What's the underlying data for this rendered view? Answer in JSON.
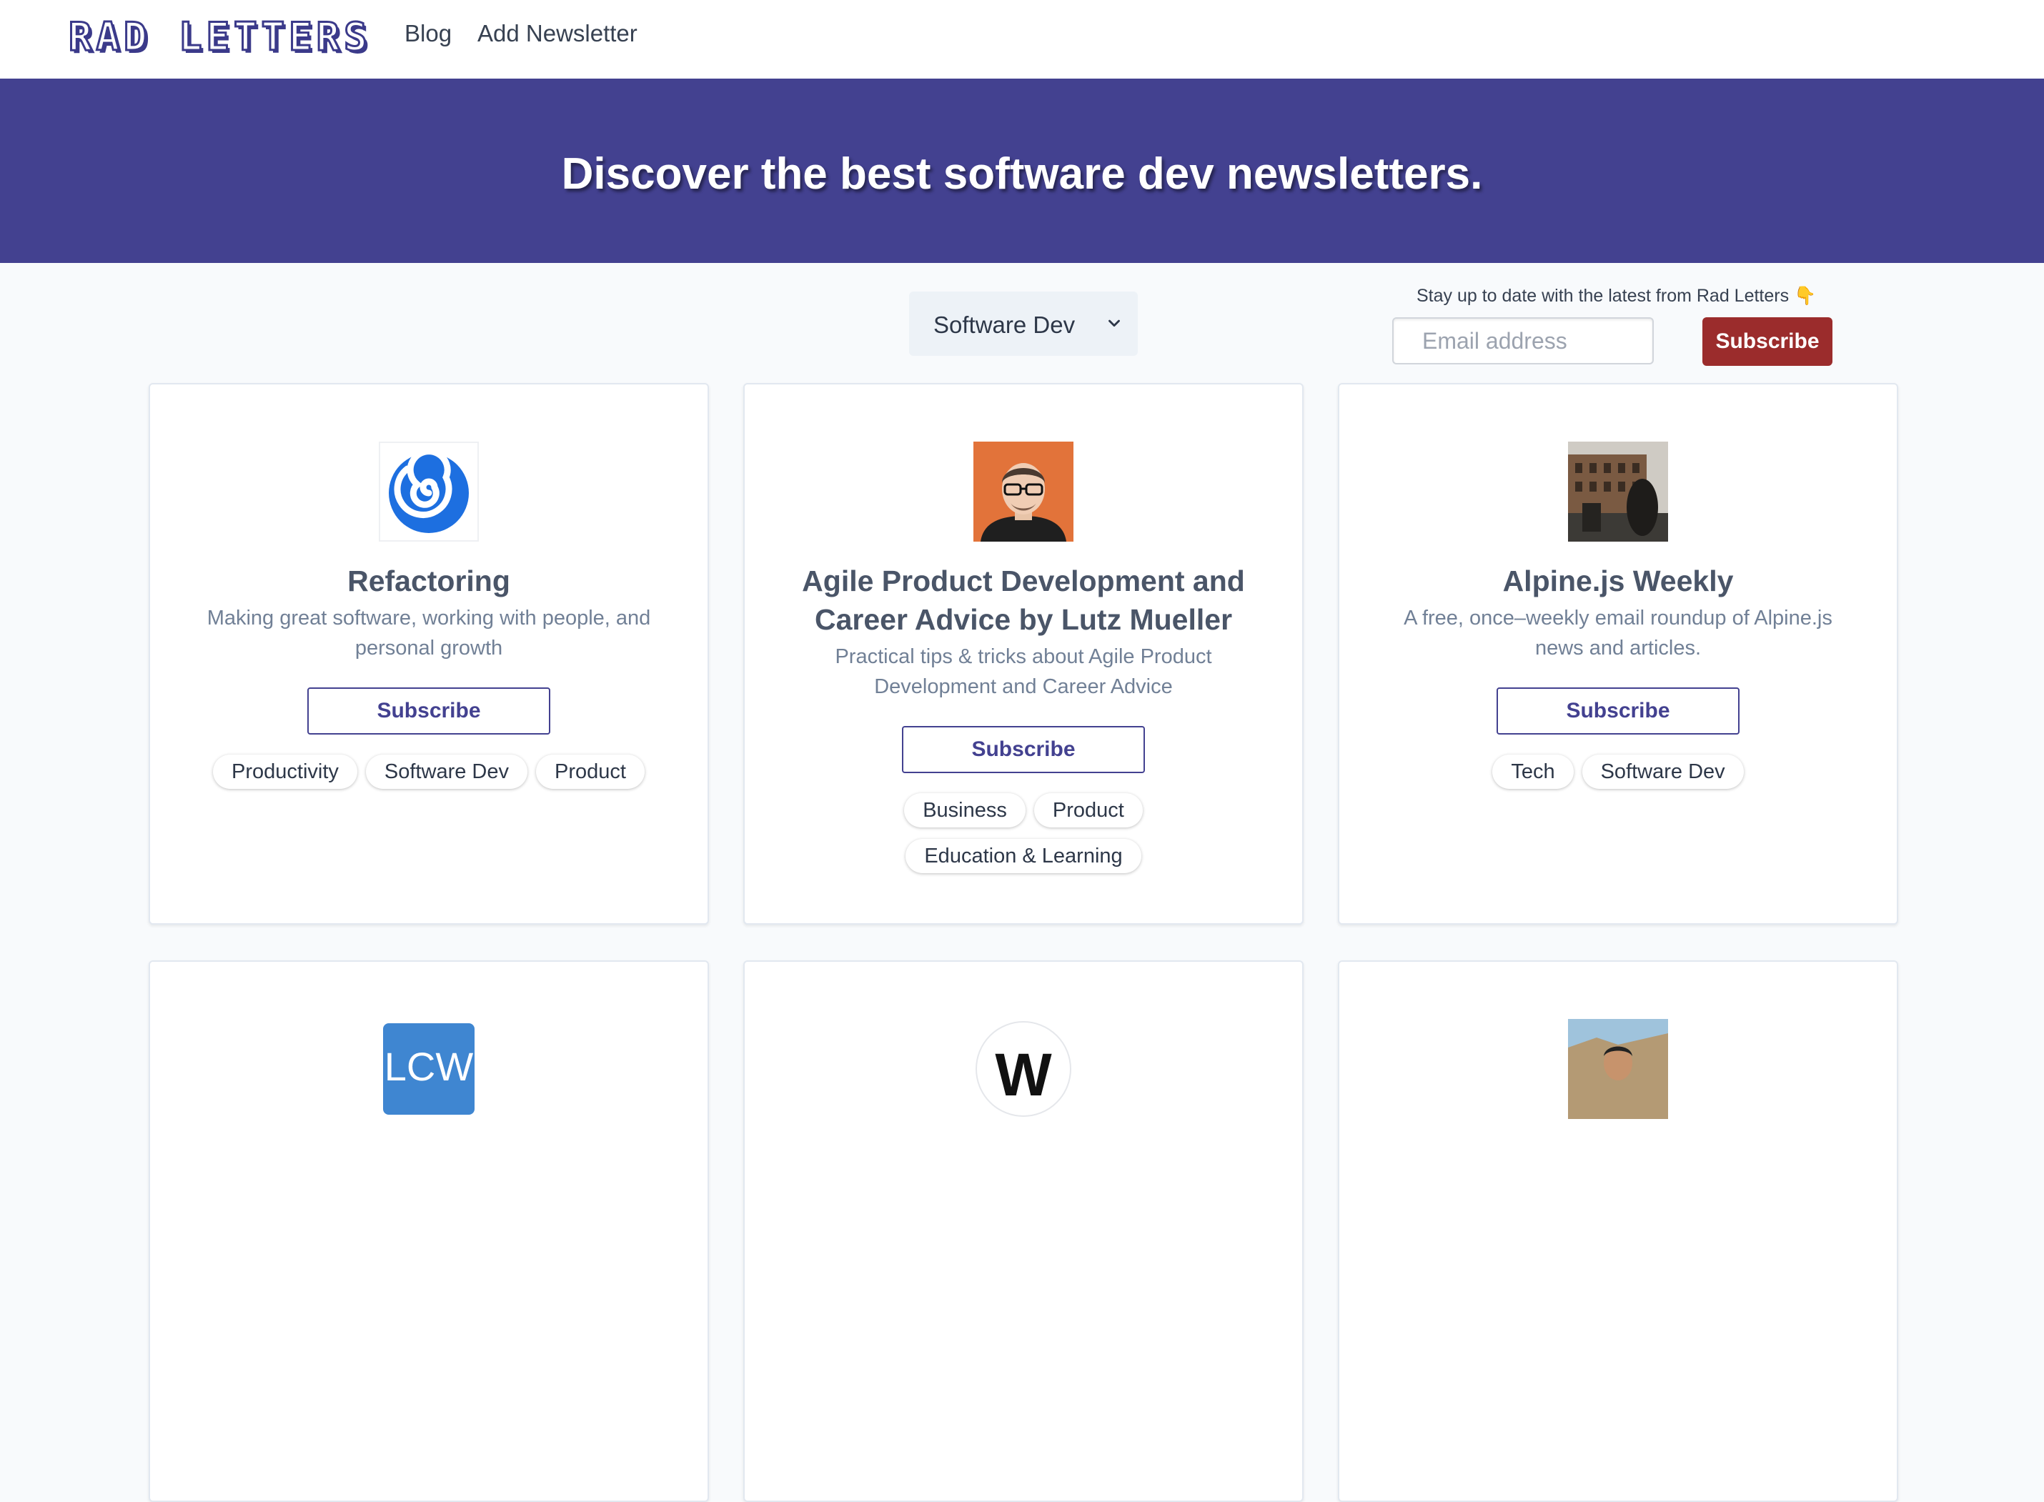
{
  "nav": {
    "logo": "RAD LETTERS",
    "links": [
      "Blog",
      "Add Newsletter"
    ]
  },
  "hero": {
    "title": "Discover the best software dev newsletters."
  },
  "filter": {
    "selected": "Software Dev"
  },
  "signup": {
    "note": "Stay up to date with the latest from Rad Letters 👇",
    "placeholder": "Email address",
    "button": "Subscribe"
  },
  "cards": [
    {
      "title": "Refactoring",
      "description": "Making great software, working with people, and personal growth",
      "button": "Subscribe",
      "tags": [
        "Productivity",
        "Software Dev",
        "Product"
      ],
      "icon": "spiral-logo-icon"
    },
    {
      "title": "Agile Product Development and Career Advice by Lutz Mueller",
      "description": "Practical tips & tricks about Agile Product Development and Career Advice",
      "button": "Subscribe",
      "tags": [
        "Business",
        "Product",
        "Education & Learning"
      ],
      "icon": "author-portrait-icon"
    },
    {
      "title": "Alpine.js Weekly",
      "description": "A free, once–weekly email roundup of Alpine.js news and articles.",
      "button": "Subscribe",
      "tags": [
        "Tech",
        "Software Dev"
      ],
      "icon": "city-photo-icon"
    },
    {
      "logo_text": "LCW",
      "icon": "lcw-logo-icon"
    },
    {
      "logo_text": "W",
      "icon": "w-logo-icon"
    },
    {
      "icon": "coast-photo-icon"
    }
  ],
  "colors": {
    "brand": "#434190",
    "subscribe": "#9b2c2c",
    "background": "#f8fafc"
  }
}
